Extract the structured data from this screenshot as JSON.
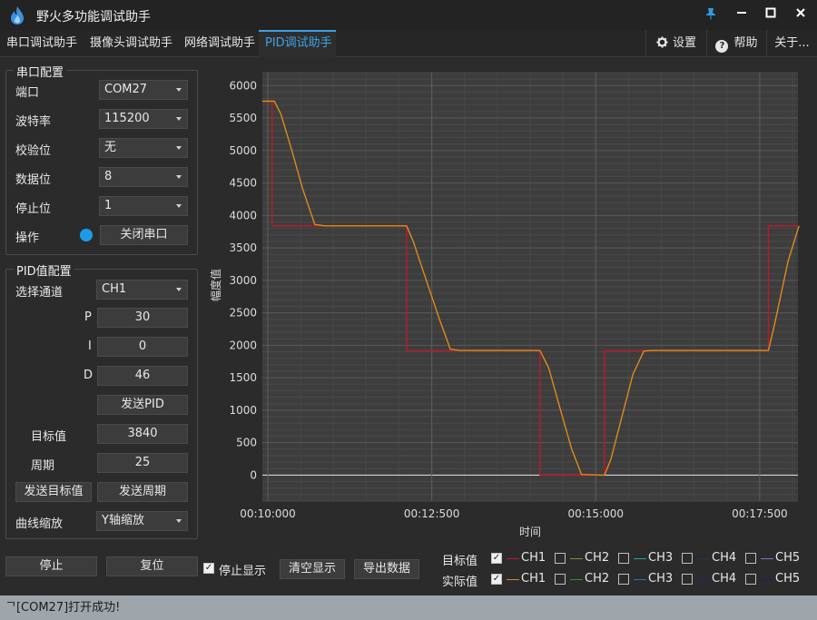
{
  "window": {
    "title": "野火多功能调试助手"
  },
  "tabs": [
    {
      "label": "串口调试助手"
    },
    {
      "label": "摄像头调试助手"
    },
    {
      "label": "网络调试助手"
    },
    {
      "label": "PID调试助手",
      "active": true
    }
  ],
  "right_tabs": {
    "settings": "设置",
    "help": "帮助",
    "about": "关于..."
  },
  "serial": {
    "group_title": "串口配置",
    "port_label": "端口",
    "port_value": "COM27",
    "baud_label": "波特率",
    "baud_value": "115200",
    "parity_label": "校验位",
    "parity_value": "无",
    "databits_label": "数据位",
    "databits_value": "8",
    "stopbits_label": "停止位",
    "stopbits_value": "1",
    "op_label": "操作",
    "close_button": "关闭串口",
    "status_color": "#1e9be8"
  },
  "pid": {
    "group_title": "PID值配置",
    "channel_label": "选择通道",
    "channel_value": "CH1",
    "p_label": "P",
    "p_value": "30",
    "i_label": "I",
    "i_value": "0",
    "d_label": "D",
    "d_value": "46",
    "send_pid": "发送PID",
    "target_label": "目标值",
    "target_value": "3840",
    "period_label": "周期",
    "period_value": "25",
    "send_target": "发送目标值",
    "send_period": "发送周期",
    "zoom_label": "曲线缩放",
    "zoom_value": "Y轴缩放"
  },
  "bottom": {
    "stop": "停止",
    "reset": "复位",
    "stop_display": "停止显示",
    "clear_display": "清空显示",
    "export_data": "导出数据",
    "target_row_label": "目标值",
    "actual_row_label": "实际值",
    "target_channels": [
      {
        "name": "CH1",
        "checked": true,
        "color": "#c0182a"
      },
      {
        "name": "CH2",
        "checked": false,
        "color": "#8a8a2a"
      },
      {
        "name": "CH3",
        "checked": false,
        "color": "#1aa5a5"
      },
      {
        "name": "CH4",
        "checked": false,
        "color": "#1a3a5a"
      },
      {
        "name": "CH5",
        "checked": false,
        "color": "#8e6bc4"
      }
    ],
    "actual_channels": [
      {
        "name": "CH1",
        "checked": true,
        "color": "#e08a1a"
      },
      {
        "name": "CH2",
        "checked": false,
        "color": "#3a8a3a"
      },
      {
        "name": "CH3",
        "checked": false,
        "color": "#1a78c4"
      },
      {
        "name": "CH4",
        "checked": false,
        "color": "#1a2a6a"
      },
      {
        "name": "CH5",
        "checked": false,
        "color": "#2a1a5a"
      }
    ]
  },
  "status": {
    "text": "ᄀ[COM27]打开成功!"
  },
  "chart_data": {
    "type": "line",
    "xlabel": "时间",
    "ylabel": "幅度值",
    "x_ticks": [
      "00:10:000",
      "00:12:500",
      "00:15:000",
      "00:17:500"
    ],
    "x_tick_seconds": [
      600,
      750,
      900,
      1050
    ],
    "xlim_seconds": [
      595,
      1085
    ],
    "y_ticks": [
      0,
      500,
      1000,
      1500,
      2000,
      2500,
      3000,
      3500,
      4000,
      4500,
      5000,
      5500,
      6000
    ],
    "ylim": [
      -400,
      6200
    ],
    "grid": true,
    "series": [
      {
        "name": "目标值 CH1",
        "color": "#c0182a",
        "x": [
          595,
          604,
          604,
          727,
          727,
          849,
          849,
          908,
          908,
          1058,
          1058,
          1085
        ],
        "y": [
          5760,
          5760,
          3840,
          3840,
          1920,
          1920,
          0,
          0,
          1920,
          1920,
          3840,
          3840
        ]
      },
      {
        "name": "实际值 CH1",
        "color": "#e08a1a",
        "x": [
          595,
          606,
          612,
          622,
          632,
          643,
          652,
          660,
          727,
          733,
          745,
          757,
          767,
          776,
          849,
          857,
          867,
          878,
          887,
          908,
          914,
          924,
          934,
          944,
          950,
          1058,
          1064,
          1076,
          1086
        ],
        "y": [
          5760,
          5760,
          5560,
          5000,
          4400,
          3860,
          3840,
          3840,
          3840,
          3600,
          3000,
          2400,
          1940,
          1920,
          1920,
          1650,
          1050,
          400,
          10,
          0,
          250,
          900,
          1550,
          1910,
          1920,
          1920,
          2350,
          3300,
          3840
        ]
      }
    ]
  }
}
